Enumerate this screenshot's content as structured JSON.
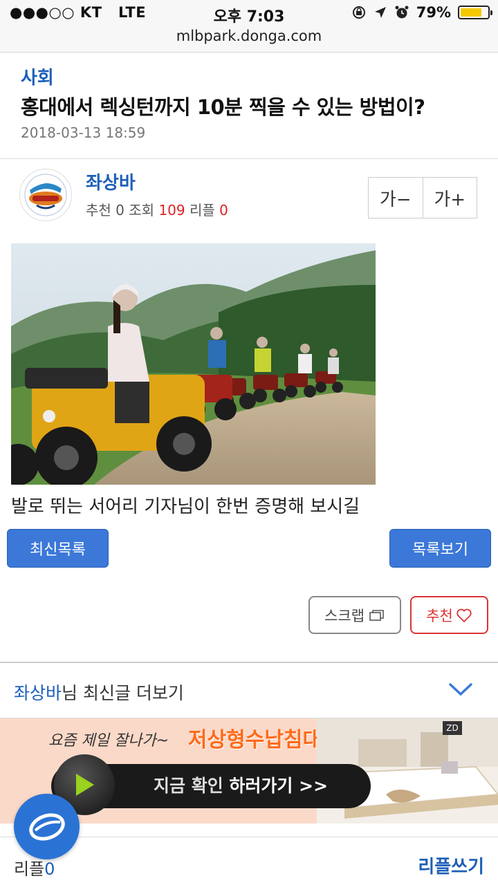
{
  "status_bar": {
    "carrier": "●●●○○ KT",
    "network": "LTE",
    "time": "오후 7:03",
    "battery": "79%",
    "battery_level": 0.79
  },
  "browser": {
    "url": "mlbpark.donga.com"
  },
  "article": {
    "category": "사회",
    "title": "홍대에서 렉싱턴까지 10분 찍을 수 있는 방법이?",
    "date": "2018-03-13 18:59",
    "body_text": "발로 뛰는 서어리 기자님이 한번 증명해 보시길"
  },
  "author": {
    "name": "좌상바",
    "recommend_label": "추천",
    "recommend_count": "0",
    "views_label": "조회",
    "views_count": "109",
    "replies_label": "리플",
    "replies_count": "0"
  },
  "font_controls": {
    "decrease": "가−",
    "increase": "가+"
  },
  "actions": {
    "latest_list": "최신목록",
    "view_list": "목록보기",
    "scrap": "스크랩",
    "recommend": "추천"
  },
  "more_posts": {
    "author": "좌상바",
    "suffix": "님 최신글 더보기"
  },
  "ad": {
    "tagline": "요즘 제일 잘나가~",
    "headline": "저상형수납침대",
    "cta_prefix": "지금 확인 ",
    "cta_bold": "하러가기 >>",
    "logo": "ZD"
  },
  "reply_bar": {
    "label": "리플",
    "count": "0",
    "write": "리플쓰기"
  },
  "colors": {
    "accent": "#1e5fb8",
    "button": "#3b78d8",
    "recommend": "#d33333"
  }
}
